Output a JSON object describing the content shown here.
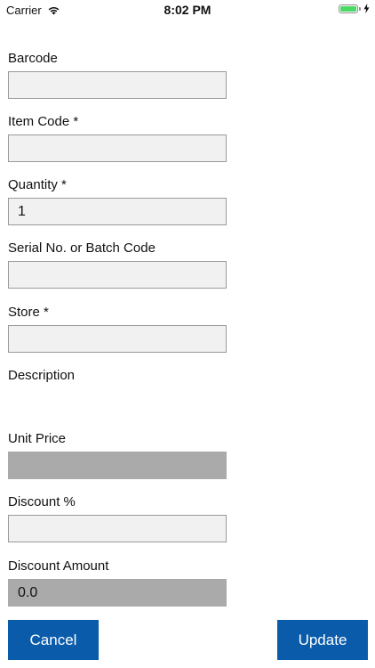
{
  "status_bar": {
    "carrier": "Carrier",
    "time": "8:02 PM",
    "battery_level": 1.0,
    "wifi_icon": "wifi-icon",
    "charging_icon": "bolt-icon"
  },
  "form": {
    "barcode": {
      "label": "Barcode",
      "value": ""
    },
    "item_code": {
      "label": "Item Code *",
      "value": ""
    },
    "quantity": {
      "label": "Quantity *",
      "value": "1"
    },
    "serial_batch": {
      "label": "Serial No. or Batch Code",
      "value": ""
    },
    "store": {
      "label": "Store *",
      "value": ""
    },
    "description": {
      "label": "Description"
    },
    "unit_price": {
      "label": "Unit Price",
      "value": ""
    },
    "discount_percent": {
      "label": "Discount %",
      "value": ""
    },
    "discount_amount": {
      "label": "Discount Amount",
      "value": "0.0"
    }
  },
  "buttons": {
    "cancel": "Cancel",
    "update": "Update"
  },
  "colors": {
    "button_bg": "#0a5cab",
    "readonly_bg": "#aaaaaa",
    "input_bg": "#f1f1f1",
    "battery": "#4cd964"
  }
}
